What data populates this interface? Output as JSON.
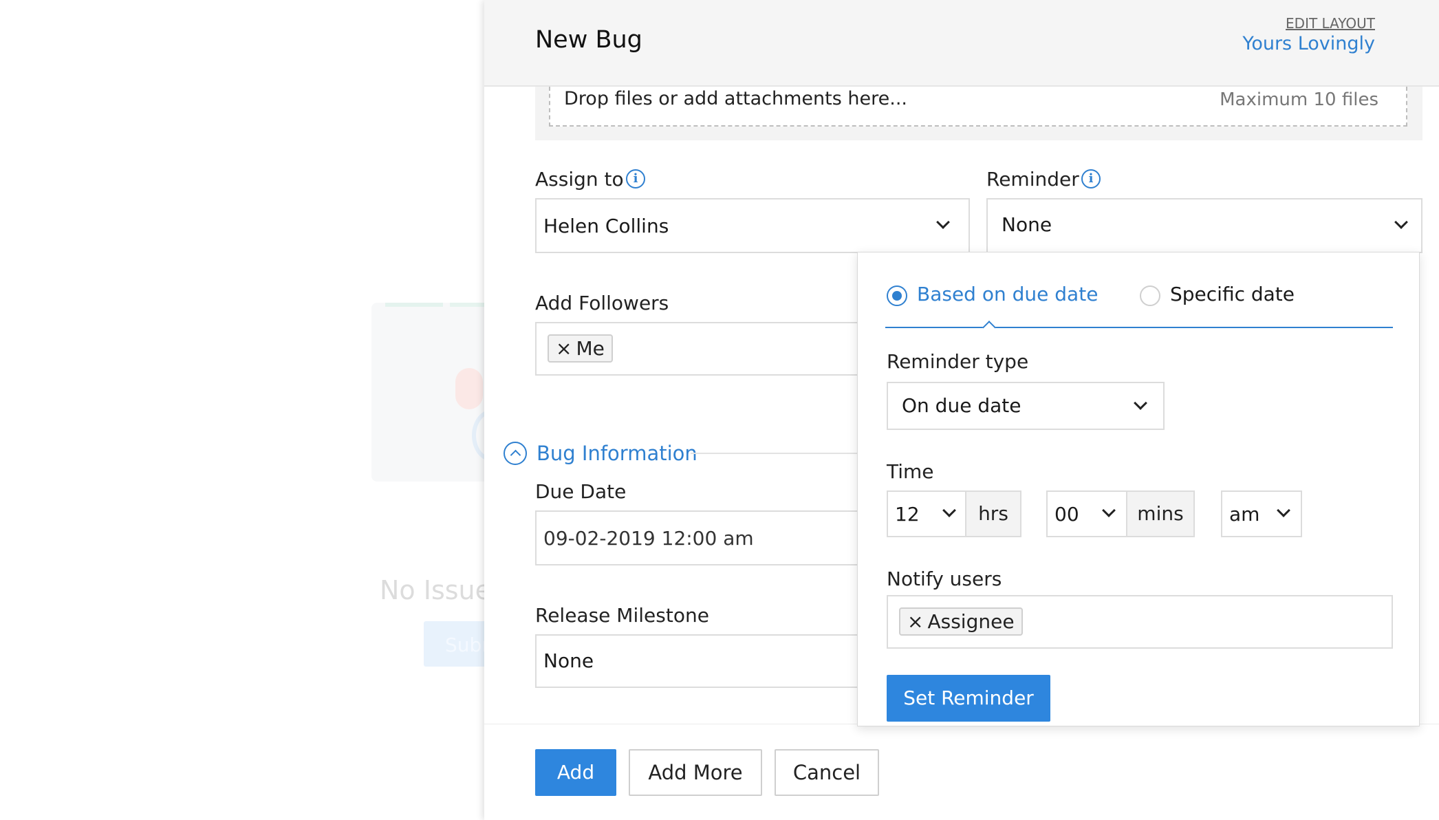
{
  "background": {
    "empty_text": "No Issue",
    "submit_label": "Subm"
  },
  "panel": {
    "title": "New Bug",
    "edit_layout": "EDIT LAYOUT",
    "layout_name": "Yours Lovingly"
  },
  "attachments": {
    "placeholder": "Drop files or add attachments here...",
    "limit": "Maximum 10 files"
  },
  "assign_to": {
    "label": "Assign to",
    "value": "Helen Collins"
  },
  "reminder": {
    "label": "Reminder",
    "value": "None"
  },
  "followers": {
    "label": "Add Followers",
    "tags": [
      "Me"
    ]
  },
  "bug_information": {
    "section_title": "Bug Information",
    "due_date_label": "Due Date",
    "due_date_value": "09-02-2019 12:00 am",
    "milestone_label": "Release Milestone",
    "milestone_value": "None"
  },
  "reminder_popover": {
    "options": [
      {
        "label": "Based on due date",
        "selected": true
      },
      {
        "label": "Specific date",
        "selected": false
      }
    ],
    "reminder_type_label": "Reminder type",
    "reminder_type_value": "On due date",
    "time_label": "Time",
    "hours": "12",
    "hours_unit": "hrs",
    "minutes": "00",
    "minutes_unit": "mins",
    "meridiem": "am",
    "notify_label": "Notify users",
    "notify_tags": [
      "Assignee"
    ],
    "set_button": "Set Reminder"
  },
  "footer": {
    "add": "Add",
    "add_more": "Add More",
    "cancel": "Cancel"
  },
  "colors": {
    "accent": "#2e86de",
    "link": "#2f80d0"
  },
  "icons": {
    "info": "info-icon",
    "chevron": "chevron-down-icon",
    "remove": "close-icon",
    "collapse": "chevron-up-circle-icon"
  }
}
